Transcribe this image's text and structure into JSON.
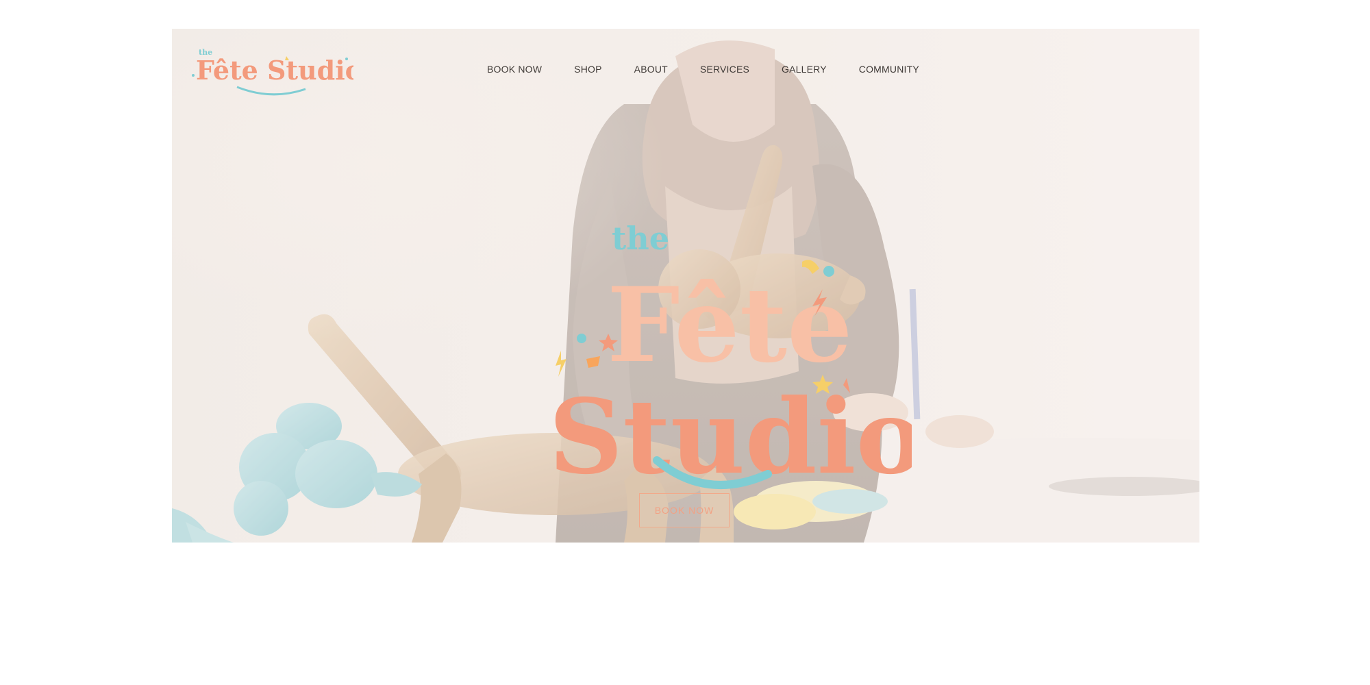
{
  "brand": {
    "small_the": "the",
    "small_name": "Fête Studio",
    "big_the": "the",
    "big_word1": "Fête",
    "big_word2": "Studio",
    "colors": {
      "coral": "#f39a7c",
      "peach": "#f8c0a6",
      "yellow": "#f6cf68",
      "teal": "#7fcdd3",
      "orange": "#f8a55c"
    }
  },
  "nav": {
    "items": [
      {
        "label": "BOOK NOW",
        "name": "nav-book-now"
      },
      {
        "label": "SHOP",
        "name": "nav-shop"
      },
      {
        "label": "ABOUT",
        "name": "nav-about"
      },
      {
        "label": "SERVICES",
        "name": "nav-services"
      },
      {
        "label": "GALLERY",
        "name": "nav-gallery"
      },
      {
        "label": "COMMUNITY",
        "name": "nav-community"
      }
    ]
  },
  "hero": {
    "cta_label": "BOOK NOW"
  }
}
